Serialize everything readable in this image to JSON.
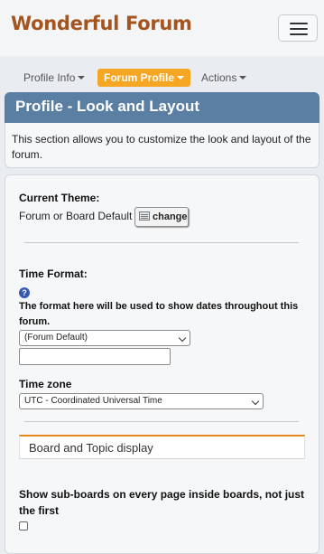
{
  "header": {
    "site_title": "Wonderful Forum",
    "menu_icon": "hamburger-icon"
  },
  "tabs": [
    {
      "label": "Profile Info",
      "active": false
    },
    {
      "label": "Forum Profile",
      "active": true
    },
    {
      "label": "Actions",
      "active": false
    }
  ],
  "panel": {
    "title": "Profile - Look and Layout",
    "description": "This section allows you to customize the look and layout of the forum."
  },
  "form": {
    "current_theme_label": "Current Theme:",
    "current_theme_value": "Forum or Board Default",
    "change_button": "change",
    "time_format_label": "Time Format:",
    "time_format_help": "The format here will be used to show dates throughout this forum.",
    "time_format_select": "(Forum Default)",
    "time_format_input": "",
    "timezone_label": "Time zone",
    "timezone_select": "UTC - Coordinated Universal Time",
    "section_title": "Board and Topic display",
    "subboards_label": "Show sub-boards on every page inside boards, not just the first",
    "subboards_checked": false
  },
  "colors": {
    "brand": "#a4541f",
    "active_tab": "#f5a623",
    "panel_header": "#5b7fa3",
    "section_accent": "#e8861c"
  }
}
